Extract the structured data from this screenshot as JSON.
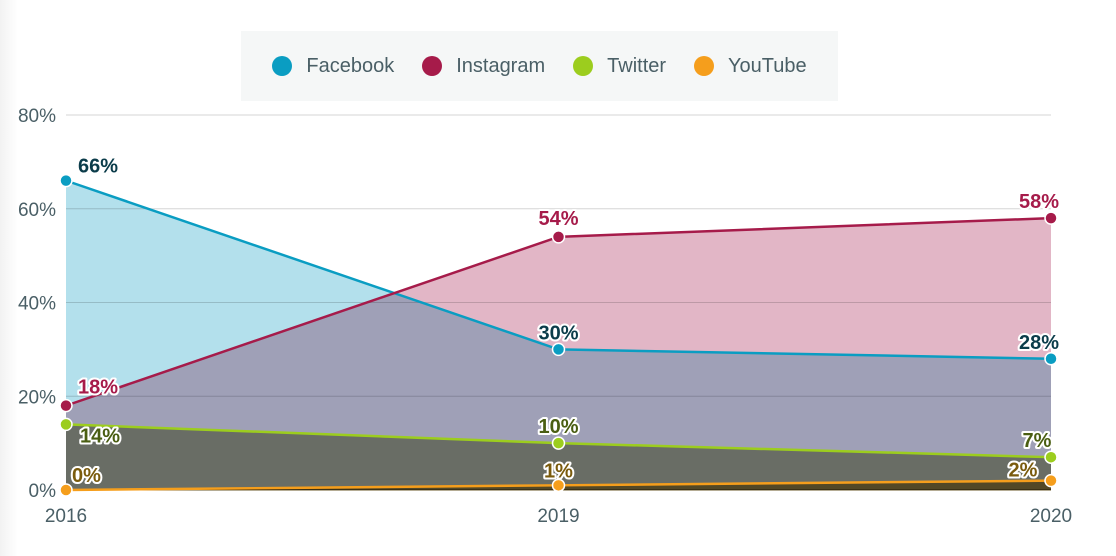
{
  "chart_data": {
    "type": "area",
    "title": "",
    "xlabel": "",
    "ylabel": "",
    "categories": [
      "2016",
      "2019",
      "2020"
    ],
    "ylim": [
      0,
      80
    ],
    "yticks": [
      0,
      20,
      40,
      60,
      80
    ],
    "ytick_labels": [
      "0%",
      "20%",
      "40%",
      "60%",
      "80%"
    ],
    "grid": true,
    "legend_position": "top-center",
    "series": [
      {
        "name": "Facebook",
        "color": "#0a9dc2",
        "fill": "#b3e0ec",
        "label_color": "#0b3c4a",
        "values": [
          66,
          30,
          28
        ],
        "labels": [
          "66%",
          "30%",
          "28%"
        ]
      },
      {
        "name": "Instagram",
        "color": "#a61b4a",
        "fill": "#e2b6c6",
        "label_color": "#a61b4a",
        "values": [
          18,
          54,
          58
        ],
        "labels": [
          "18%",
          "54%",
          "58%"
        ]
      },
      {
        "name": "Twitter",
        "color": "#9ccd1e",
        "fill": "#a8ad8c",
        "label_color": "#4a5e12",
        "values": [
          14,
          10,
          7
        ],
        "labels": [
          "14%",
          "10%",
          "7%"
        ]
      },
      {
        "name": "YouTube",
        "color": "#f59e1c",
        "fill": "#c9a860",
        "label_color": "#7a5b0d",
        "values": [
          0,
          1,
          2
        ],
        "labels": [
          "0%",
          "1%",
          "2%"
        ]
      }
    ],
    "overlap_fill": "#aba2b9"
  },
  "legend": {
    "items": [
      {
        "label": "Facebook",
        "color": "#0a9dc2"
      },
      {
        "label": "Instagram",
        "color": "#a61b4a"
      },
      {
        "label": "Twitter",
        "color": "#9ccd1e"
      },
      {
        "label": "YouTube",
        "color": "#f59e1c"
      }
    ]
  }
}
